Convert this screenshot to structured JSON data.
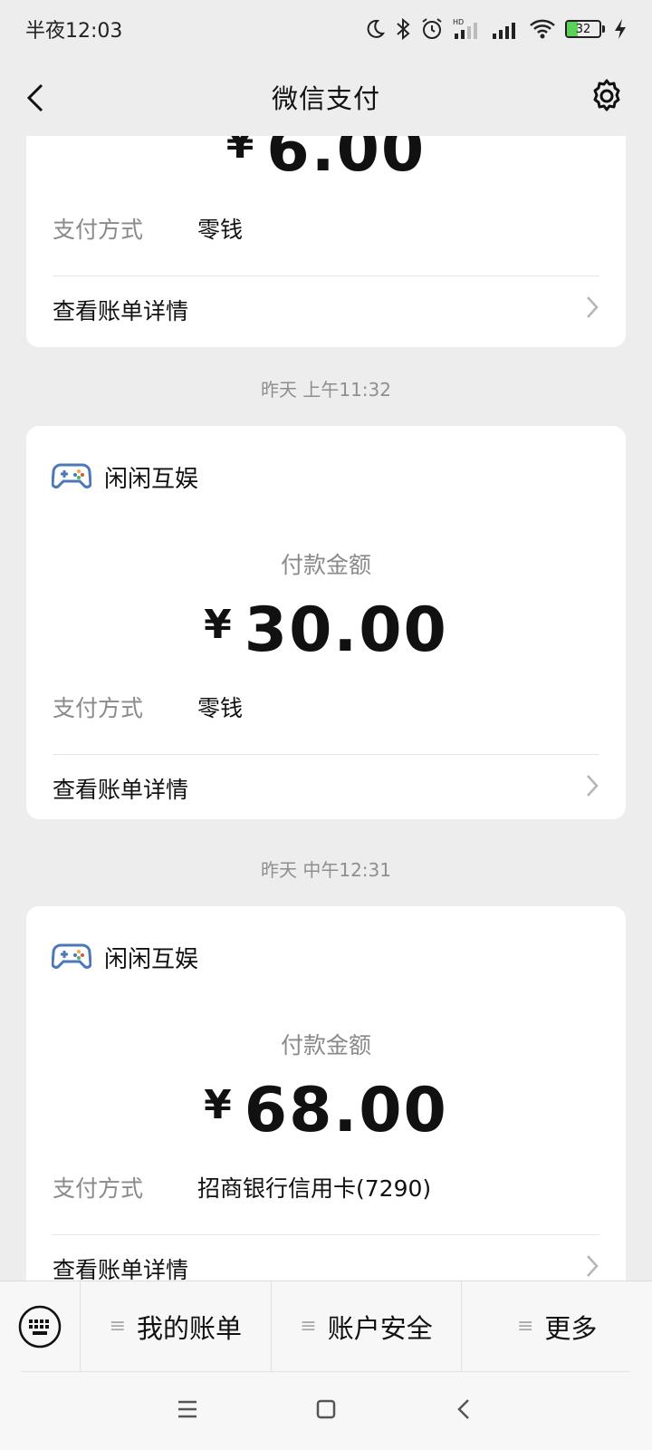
{
  "status_bar": {
    "time": "半夜12:03",
    "battery_percent": "32",
    "battery_level": 0.32,
    "icons": [
      "moon-icon",
      "bluetooth-icon",
      "alarm-icon",
      "hd-signal-icon",
      "signal-icon",
      "wifi-icon",
      "battery-icon",
      "charging-icon"
    ]
  },
  "header": {
    "title": "微信支付"
  },
  "cards": [
    {
      "amount": "6.00",
      "currency": "¥",
      "pay_method_label": "支付方式",
      "pay_method_value": "零钱",
      "detail_label": "查看账单详情"
    },
    {
      "timestamp": "昨天 上午11:32",
      "merchant": "闲闲互娱",
      "amount_label": "付款金额",
      "currency": "¥",
      "amount": "30.00",
      "pay_method_label": "支付方式",
      "pay_method_value": "零钱",
      "detail_label": "查看账单详情"
    },
    {
      "timestamp": "昨天 中午12:31",
      "merchant": "闲闲互娱",
      "amount_label": "付款金额",
      "currency": "¥",
      "amount": "68.00",
      "pay_method_label": "支付方式",
      "pay_method_value": "招商银行信用卡(7290)",
      "detail_label": "查看账单详情"
    }
  ],
  "bottom_menu": {
    "items": [
      {
        "label": "我的账单"
      },
      {
        "label": "账户安全"
      },
      {
        "label": "更多"
      }
    ]
  },
  "colors": {
    "background": "#ededed",
    "card": "#ffffff",
    "gamepad_blue": "#4a78b8",
    "battery_green": "#5bd15b"
  }
}
